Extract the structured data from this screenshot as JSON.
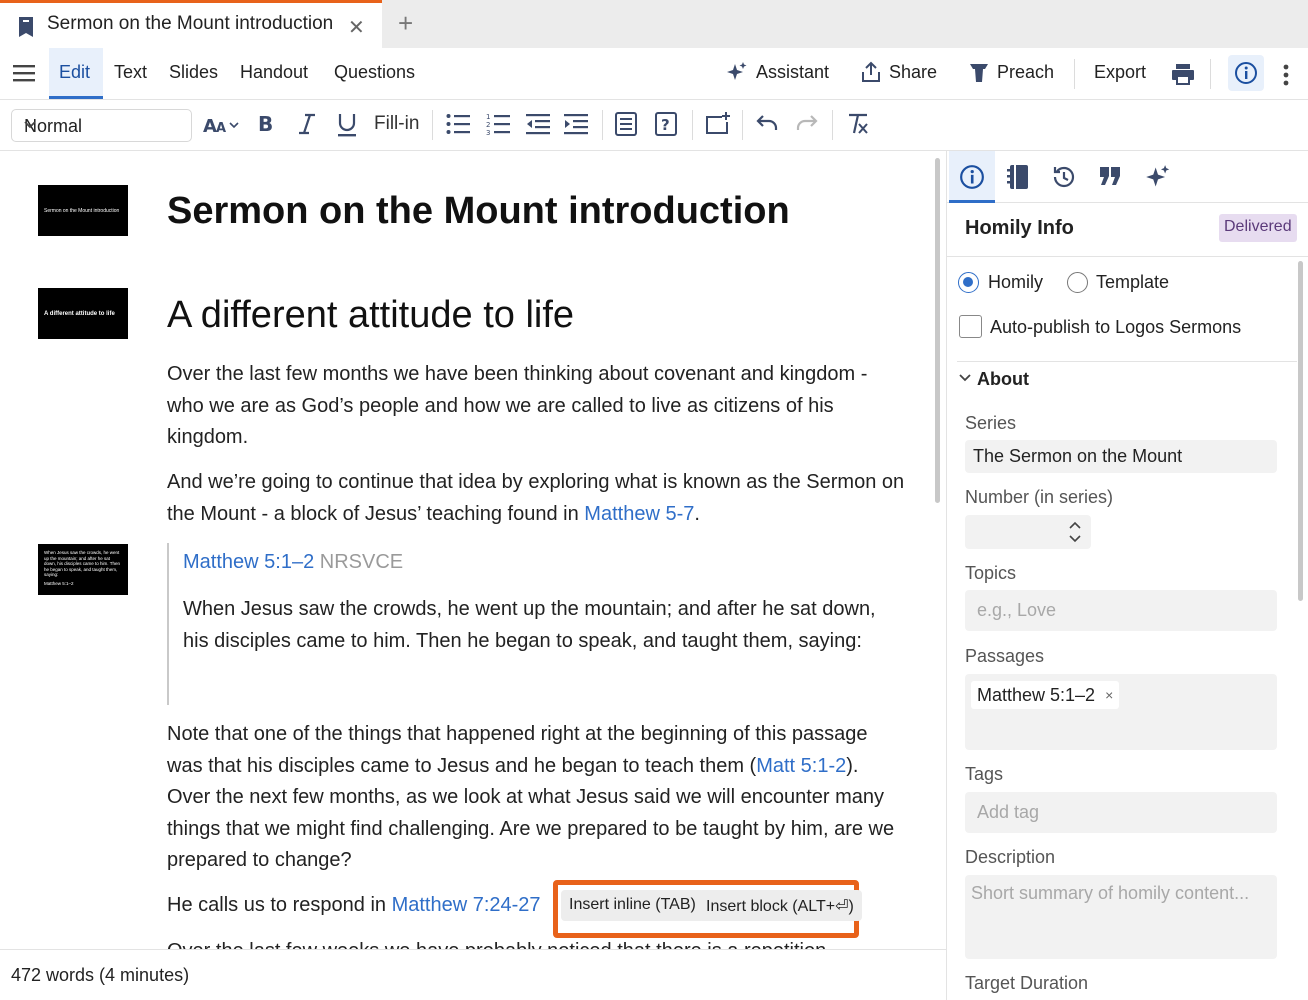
{
  "tab": {
    "title": "Sermon on the Mount introduction",
    "close": "✕",
    "new": "+"
  },
  "menu": {
    "items": [
      "Edit",
      "Text",
      "Slides",
      "Handout",
      "Questions"
    ],
    "assistant": "Assistant",
    "share": "Share",
    "preach": "Preach",
    "export": "Export"
  },
  "toolbar": {
    "style": "Normal",
    "fill_in": "Fill-in"
  },
  "document": {
    "thumb1": "Sermon on the Mount introduction",
    "thumb2": "A different attitude to life",
    "thumb3": "When Jesus saw the crowds, he went up the mountain; and after he sat down, his disciples came to him. Then he began to speak, and taught them, saying:",
    "thumb3_ref": "Matthew 5:1–2",
    "title": "Sermon on the Mount introduction",
    "heading": "A different attitude to life",
    "p1": "Over the last few months we have been thinking about covenant and kingdom - who we are as God’s people and how we are called to live as citizens of his kingdom.",
    "p2_pre": "And we’re going to continue that idea by exploring what is known as the Sermon on the Mount - a block of Jesus’ teaching found in ",
    "p2_link": "Matthew 5-7",
    "p2_post": ".",
    "quote_ref": "Matthew 5:1–2",
    "quote_version": "NRSVCE",
    "quote_text": "When Jesus saw the crowds, he went up the mountain; and after he sat down, his disciples came to him. Then he began to speak, and taught them, saying:",
    "p3_pre": "Note that one of the things that happened right at the beginning of this passage was that his disciples came to Jesus and he began to teach them (",
    "p3_link": "Matt 5:1-2",
    "p3_post": "). Over the next few months, as we look at what Jesus said we will encounter many things that we might find challenging. Are we prepared to be taught by him, are we prepared to change?",
    "p4_pre": "He calls us to respond in ",
    "p4_link": "Matthew 7:24-27",
    "p5_partial": "Over the last few weeks we have probably noticed that there is a repetition",
    "insert_inline": "Insert inline (TAB)",
    "insert_block": "Insert block (ALT+⏎)"
  },
  "status": {
    "words": "472 words (4 minutes)"
  },
  "panel": {
    "title": "Homily Info",
    "badge": "Delivered",
    "radio_homily": "Homily",
    "radio_template": "Template",
    "autopublish": "Auto-publish to Logos Sermons",
    "about": "About",
    "series_label": "Series",
    "series_value": "The Sermon on the Mount",
    "number_label": "Number (in series)",
    "topics_label": "Topics",
    "topics_placeholder": "e.g., Love",
    "passages_label": "Passages",
    "passage_tag": "Matthew 5:1–2",
    "passage_remove": "×",
    "tags_label": "Tags",
    "tags_placeholder": "Add tag",
    "description_label": "Description",
    "description_placeholder": "Short summary of homily content...",
    "target_label": "Target Duration"
  },
  "colors": {
    "accent": "#2f6ec8",
    "highlight": "#e8621a",
    "badge_bg": "#e7dcf0"
  }
}
